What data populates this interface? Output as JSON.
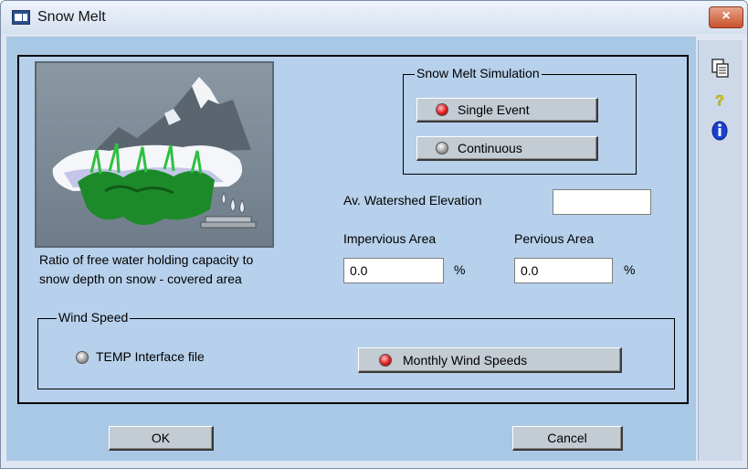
{
  "window": {
    "title": "Snow Melt",
    "close_label": "×"
  },
  "illustration": {
    "icon": "snow-melt-illustration"
  },
  "description": {
    "line1": "Ratio of free water holding capacity to",
    "line2": "snow depth on snow - covered area"
  },
  "simulation": {
    "label": "Snow Melt Simulation",
    "single_event": {
      "label": "Single Event",
      "state": "red"
    },
    "continuous": {
      "label": "Continuous",
      "state": "gray"
    }
  },
  "elevation": {
    "label": "Av. Watershed Elevation",
    "value": ""
  },
  "impervious": {
    "label": "Impervious Area",
    "value": "0.0",
    "unit": "%"
  },
  "pervious": {
    "label": "Pervious Area",
    "value": "0.0",
    "unit": "%"
  },
  "wind": {
    "label": "Wind Speed",
    "temp_option": "TEMP Interface file",
    "monthly_label": "Monthly Wind Speeds"
  },
  "footer": {
    "ok_label": "OK",
    "cancel_label": "Cancel"
  },
  "side_tools": {
    "copy_icon": "copy-icon",
    "help_icon": "question-icon",
    "info_icon": "info-icon"
  },
  "colors": {
    "led_red": "#e21c1c",
    "info_blue": "#1a3fd1",
    "help_yellow": "#e8d800"
  }
}
